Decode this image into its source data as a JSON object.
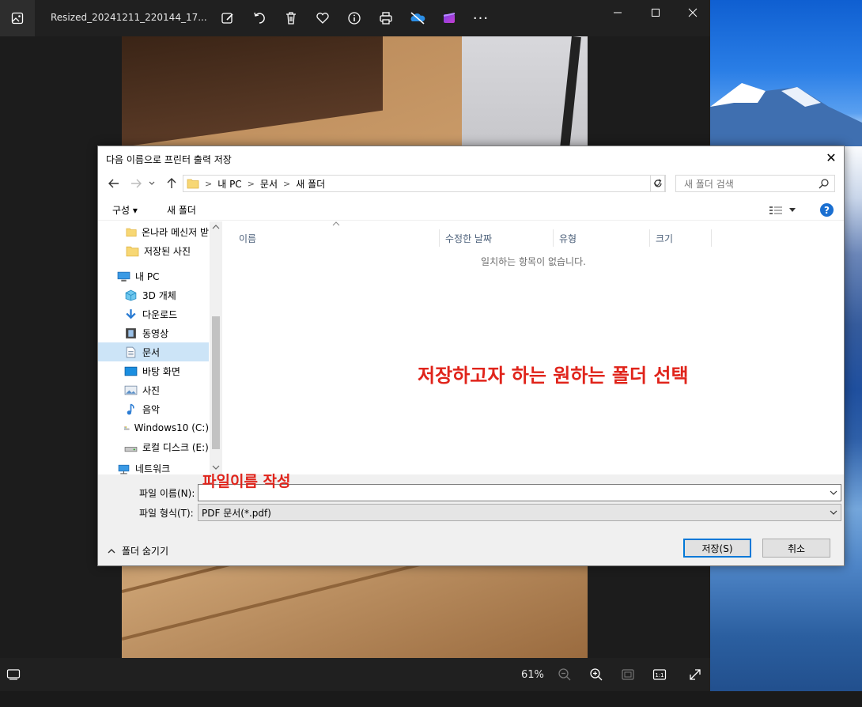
{
  "photos": {
    "file_title": "Resized_20241211_220144_17...",
    "zoom": "61%",
    "toolbar_icons": [
      "edit-icon",
      "rotate-icon",
      "delete-icon",
      "favorite-icon",
      "info-icon",
      "print-icon",
      "onedrive-icon",
      "clipchamp-icon",
      "more-icon"
    ],
    "more_label": "···"
  },
  "dialog": {
    "title": "다음 이름으로 프린터 출력 저장",
    "close_glyph": "✕",
    "breadcrumb": [
      "내 PC",
      "문서",
      "새 폴더"
    ],
    "search_placeholder": "새 폴더 검색",
    "organize_label": "구성 ▾",
    "new_folder_label": "새 폴더",
    "help_glyph": "?",
    "nav_items": [
      {
        "label": "온나라 메신저 받",
        "icon": "folder-icon"
      },
      {
        "label": "저장된 사진",
        "icon": "folder-icon"
      },
      {
        "label": "내 PC",
        "icon": "pc-icon"
      },
      {
        "label": "3D 개체",
        "icon": "cube-icon"
      },
      {
        "label": "다운로드",
        "icon": "download-icon"
      },
      {
        "label": "동영상",
        "icon": "video-icon"
      },
      {
        "label": "문서",
        "icon": "document-icon"
      },
      {
        "label": "바탕 화면",
        "icon": "desktop-icon"
      },
      {
        "label": "사진",
        "icon": "pictures-icon"
      },
      {
        "label": "음악",
        "icon": "music-icon"
      },
      {
        "label": "Windows10 (C:)",
        "icon": "drive-icon"
      },
      {
        "label": "로컬 디스크 (E:)",
        "icon": "drive-icon"
      },
      {
        "label": "네트워크",
        "icon": "network-icon"
      }
    ],
    "columns": [
      "이름",
      "수정한 날짜",
      "유형",
      "크기"
    ],
    "empty_message": "일치하는 항목이 없습니다.",
    "annotation_folder": "저장하고자 하는 원하는 폴더 선택",
    "annotation_filename": "파일이름 작성",
    "filename_label": "파일 이름(N):",
    "filename_value": "",
    "filetype_label": "파일 형식(T):",
    "filetype_value": "PDF 문서(*.pdf)",
    "hide_folders_label": "폴더 숨기기",
    "save_label": "저장(S)",
    "cancel_label": "취소"
  }
}
